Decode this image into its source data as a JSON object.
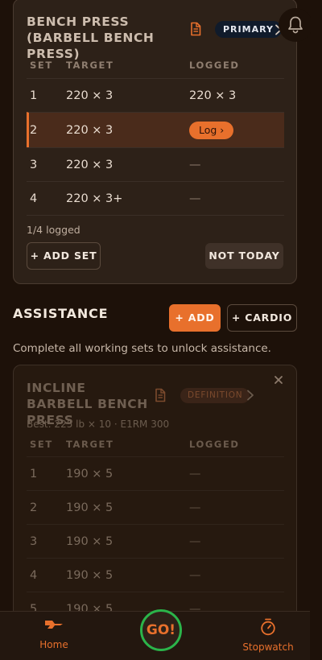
{
  "primary_exercise": {
    "title": "Bench Press (Barbell Bench Press)",
    "badge": "PRIMARY",
    "columns": [
      "SET",
      "TARGET",
      "LOGGED"
    ],
    "sets": [
      {
        "set": "1",
        "target": "220 × 3",
        "logged": "220 × 3"
      },
      {
        "set": "2",
        "target": "220 × 3",
        "logged_action": "Log ›"
      },
      {
        "set": "3",
        "target": "220 × 3",
        "logged": "—"
      },
      {
        "set": "4",
        "target": "220 × 3+",
        "logged": "—"
      }
    ],
    "progress_text": "1/4 logged",
    "add_set_label": "+ ADD SET",
    "not_today_label": "NOT TODAY"
  },
  "assistance": {
    "title": "ASSISTANCE",
    "add_label": "+ ADD",
    "cardio_label": "+ CARDIO",
    "hint": "Complete all working sets to unlock assistance.",
    "exercise": {
      "title": "Incline Barbell Bench Press",
      "badge": "DEFINITION",
      "best": "Best: 225 lb × 10 · E1RM 300",
      "columns": [
        "SET",
        "TARGET",
        "LOGGED"
      ],
      "sets": [
        {
          "set": "1",
          "target": "190 × 5",
          "logged": "—"
        },
        {
          "set": "2",
          "target": "190 × 5",
          "logged": "—"
        },
        {
          "set": "3",
          "target": "190 × 5",
          "logged": "—"
        },
        {
          "set": "4",
          "target": "190 × 5",
          "logged": "—"
        },
        {
          "set": "5",
          "target": "190 × 5",
          "logged": "—"
        }
      ]
    }
  },
  "bottom_nav": {
    "home_label": "Home",
    "go_label": "GO!",
    "stopwatch_label": "Stopwatch"
  },
  "icons": {
    "document": "document-icon",
    "chevron": "chevron-right-icon",
    "bell": "bell-icon",
    "close": "close-icon",
    "home": "barbell-icon",
    "stopwatch": "stopwatch-icon"
  },
  "colors": {
    "accent": "#e8702c",
    "go_ring": "#2bb44a",
    "background": "#1d1109",
    "card": "#2d2118"
  }
}
